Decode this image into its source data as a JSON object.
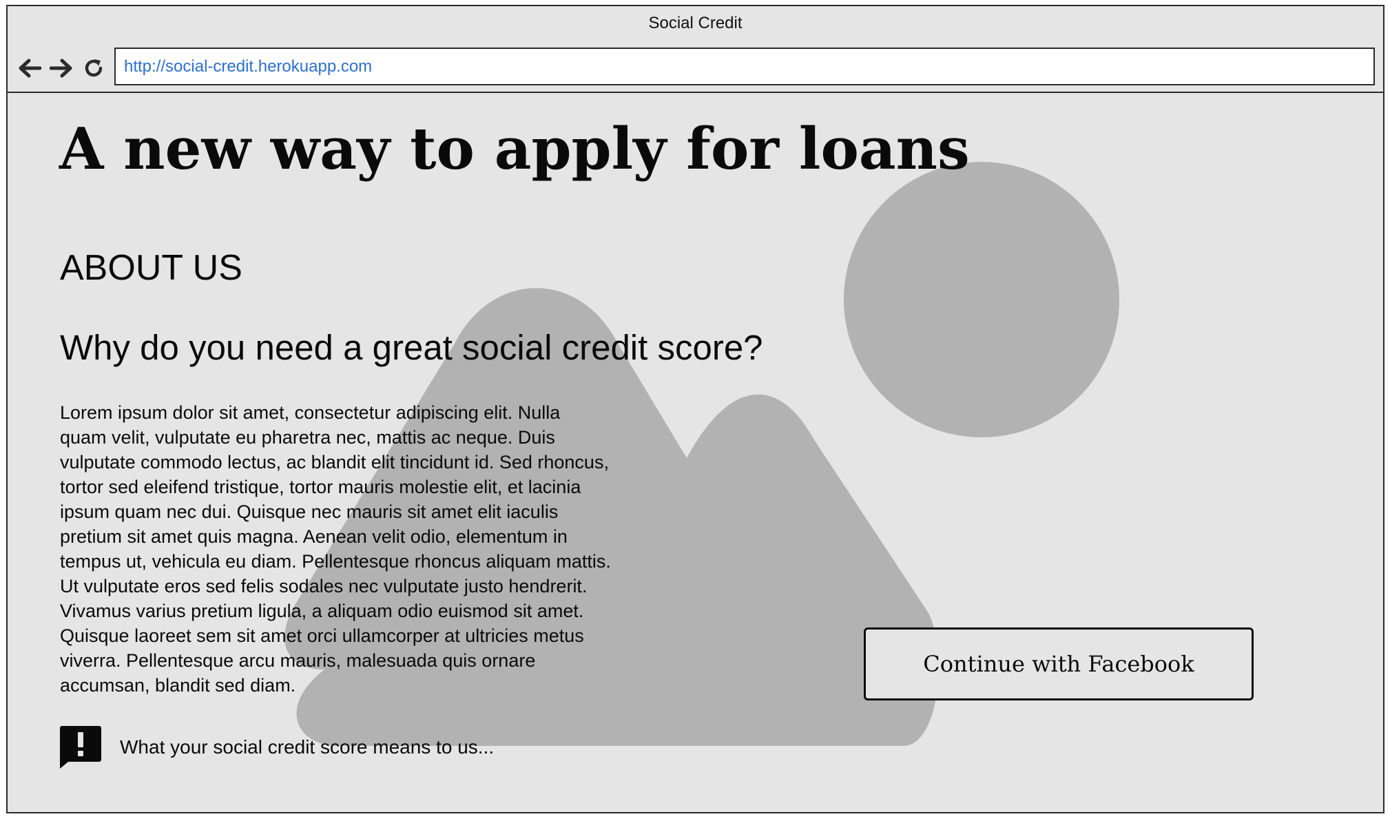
{
  "window": {
    "title": "Social Credit"
  },
  "navbar": {
    "back_icon": "arrow-left-icon",
    "forward_icon": "arrow-right-icon",
    "reload_icon": "reload-icon",
    "url": "http://social-credit.herokuapp.com",
    "url_color": "#2a6fd6"
  },
  "page": {
    "headline": "A new way to apply for loans",
    "about_heading": "ABOUT US",
    "question_heading": "Why do you need a great social credit score?",
    "body": "Lorem ipsum dolor sit amet, consectetur adipiscing elit. Nulla quam velit, vulputate eu pharetra nec, mattis ac neque. Duis vulputate commodo lectus, ac blandit elit tincidunt id. Sed rhoncus, tortor sed eleifend tristique, tortor mauris molestie elit, et lacinia ipsum quam nec dui. Quisque nec mauris sit amet elit iaculis pretium sit amet quis magna. Aenean velit odio, elementum in tempus ut, vehicula eu diam. Pellentesque rhoncus aliquam mattis. Ut vulputate eros sed felis sodales nec vulputate justo hendrerit. Vivamus varius pretium ligula, a aliquam odio euismod sit amet. Quisque laoreet sem sit amet orci ullamcorper at ultricies metus viverra. Pellentesque arcu mauris, malesuada quis ornare accumsan, blandit sed diam.",
    "facebook_button": "Continue with Facebook",
    "alert_icon": "alert-message-icon",
    "alert_text": "What your social credit score means to us...",
    "placeholder_image_icon": "image-placeholder-icon",
    "colors": {
      "background": "#e5e5e5",
      "placeholder": "#b2b2b2",
      "text": "#0a0a0a"
    }
  }
}
